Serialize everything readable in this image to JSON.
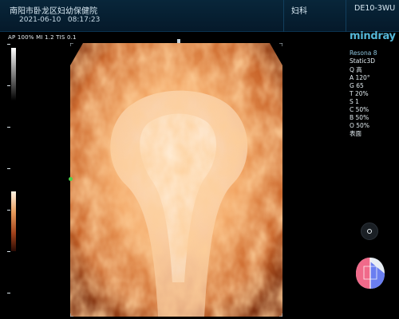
{
  "header": {
    "hospital": "南阳市卧龙区妇幼保健院",
    "date": "2021-06-10",
    "time": "08:17:23",
    "department": "妇科",
    "probe": "DE10-3WU"
  },
  "acoustic": {
    "text": "AP 100%  MI 1.2  TIS 0.1"
  },
  "brand": "mindray",
  "params": {
    "model": "Resona 8",
    "mode": "Static3D",
    "items": [
      "Q 高",
      "A 120°",
      "G 65",
      "T 20%",
      "S 1",
      "C 50%",
      "B 50%",
      "O 50%",
      "表面"
    ]
  },
  "icons": {
    "cursor": "cursor-ring-icon",
    "orientation": "orientation-globe-icon"
  },
  "colors": {
    "header_bg": "#06213a",
    "brand": "#54b7d8",
    "render_tint": "#e8a060"
  }
}
